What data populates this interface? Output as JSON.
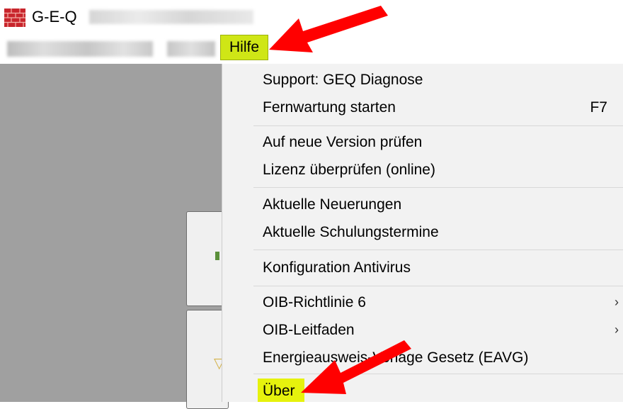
{
  "window": {
    "title": "G-E-Q",
    "icon": "brick-wall-icon"
  },
  "menubar": {
    "hilfe_label": "Hilfe",
    "highlight_color": "#cfe616"
  },
  "menu": {
    "items": [
      {
        "label": "Support: GEQ Diagnose"
      },
      {
        "label": "Fernwartung starten",
        "shortcut": "F7"
      },
      {
        "label": "Auf neue Version prüfen"
      },
      {
        "label": "Lizenz überprüfen (online)"
      },
      {
        "label": "Aktuelle Neuerungen"
      },
      {
        "label": "Aktuelle Schulungstermine"
      },
      {
        "label": "Konfiguration Antivirus"
      },
      {
        "label": "OIB-Richtlinie 6",
        "submenu": "›"
      },
      {
        "label": "OIB-Leitfaden",
        "submenu": "›"
      },
      {
        "label": "Energieausweis-Vorlage Gesetz (EAVG)"
      },
      {
        "label": "Über"
      }
    ],
    "highlight_color": "#e6f20d"
  },
  "annotations": {
    "arrow_color": "#ff0000"
  }
}
